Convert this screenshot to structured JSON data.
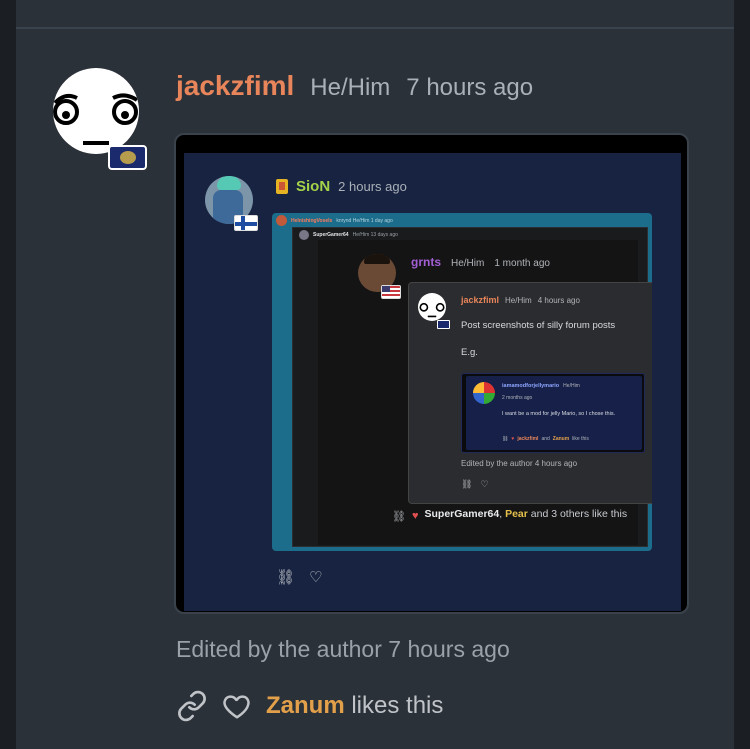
{
  "post": {
    "username": "jackzfiml",
    "pronouns": "He/Him",
    "time": "7 hours ago",
    "edited": "Edited by the author 7 hours ago",
    "likes": {
      "name": "Zanum",
      "suffix": "likes this"
    }
  },
  "screenshot": {
    "sion": {
      "name": "SioN",
      "time": "2 hours ago"
    },
    "teal_header": {
      "name": "HeInishingVosels",
      "meta": "knrynd  He/Him  1 day ago"
    },
    "dark_header": {
      "name": "SuperGamer64",
      "meta": "He/Him  13 days ago"
    },
    "grnts": {
      "name": "grnts",
      "pronouns": "He/Him",
      "time": "1 month ago"
    },
    "jackzfiml": {
      "name": "jackzfiml",
      "pronouns": "He/Him",
      "time": "4 hours ago",
      "text1": "Post screenshots of silly forum posts",
      "text2": "E.g.",
      "edited": "Edited by the author 4 hours ago"
    },
    "iam": {
      "name": "iamamodforjellymario",
      "pronouns": "He/Him",
      "time": "2 months ago",
      "text": "I want be a mod for jelly Mario, so I chose this.",
      "likes_name1": "jackzfiml",
      "likes_and": "and",
      "likes_name2": "Zanum",
      "likes_suffix": "like this"
    },
    "grnts_likes": {
      "name1": "SuperGamer64",
      "sep": ",",
      "name2": "Pear",
      "suffix": "and 3 others like this"
    }
  },
  "icons": [
    "link-icon",
    "heart-icon",
    "flag-icon"
  ],
  "colors": {
    "username": "#e9855a",
    "accent_like": "#e3a04a",
    "background": "#2b3138"
  }
}
